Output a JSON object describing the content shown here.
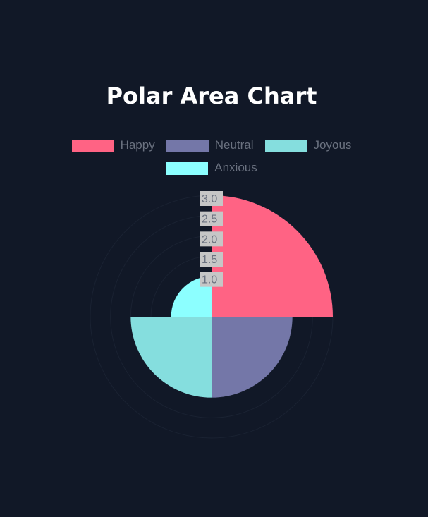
{
  "chart_data": {
    "type": "polar_area",
    "title": "Polar Area Chart",
    "categories": [
      "Happy",
      "Neutral",
      "Joyous",
      "Anxious"
    ],
    "values": [
      3.0,
      2.0,
      2.0,
      1.0
    ],
    "colors": [
      "#ff6384",
      "#7477a8",
      "#85dede",
      "#8cffff"
    ],
    "r_ticks": [
      "3.0",
      "2.5",
      "2.0",
      "1.5",
      "1.0"
    ],
    "r_range": [
      0,
      3.0
    ],
    "legend_position": "top",
    "background": "#111827"
  }
}
